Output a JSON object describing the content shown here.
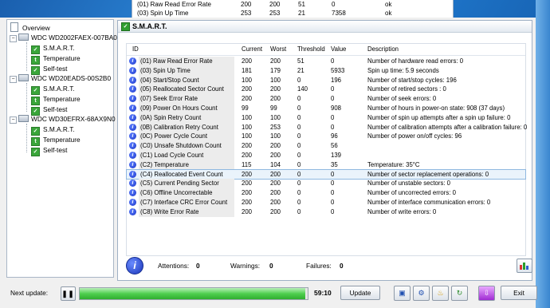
{
  "background_table": {
    "rows": [
      {
        "name": "(01) Raw Read Error Rate",
        "current": "200",
        "worst": "200",
        "threshold": "51",
        "value": "0",
        "status": "ok"
      },
      {
        "name": "(03) Spin Up Time",
        "current": "253",
        "worst": "253",
        "threshold": "21",
        "value": "7358",
        "status": "ok"
      }
    ]
  },
  "tree": {
    "overview": "Overview",
    "drives": [
      {
        "name": "WDC WD2002FAEX-007BA0",
        "children": [
          "S.M.A.R.T.",
          "Temperature",
          "Self-test"
        ]
      },
      {
        "name": "WDC WD20EADS-00S2B0",
        "children": [
          "S.M.A.R.T.",
          "Temperature",
          "Self-test"
        ]
      },
      {
        "name": "WDC WD30EFRX-68AX9N0",
        "children": [
          "S.M.A.R.T.",
          "Temperature",
          "Self-test"
        ]
      }
    ]
  },
  "panel": {
    "title": "S.M.A.R.T."
  },
  "smart_table": {
    "columns": [
      "ID",
      "Current",
      "Worst",
      "Threshold",
      "Value",
      "Description"
    ],
    "selected_index": 13,
    "rows": [
      {
        "id": "(01) Raw Read Error Rate",
        "current": "200",
        "worst": "200",
        "threshold": "51",
        "value": "0",
        "desc": "Number of hardware read errors: 0"
      },
      {
        "id": "(03) Spin Up Time",
        "current": "181",
        "worst": "179",
        "threshold": "21",
        "value": "5933",
        "desc": "Spin up time: 5.9 seconds"
      },
      {
        "id": "(04) Start/Stop Count",
        "current": "100",
        "worst": "100",
        "threshold": "0",
        "value": "196",
        "desc": "Number of start/stop cycles: 196"
      },
      {
        "id": "(05) Reallocated Sector Count",
        "current": "200",
        "worst": "200",
        "threshold": "140",
        "value": "0",
        "desc": "Number of retired sectors : 0"
      },
      {
        "id": "(07) Seek Error Rate",
        "current": "200",
        "worst": "200",
        "threshold": "0",
        "value": "0",
        "desc": "Number of seek errors: 0"
      },
      {
        "id": "(09) Power On Hours Count",
        "current": "99",
        "worst": "99",
        "threshold": "0",
        "value": "908",
        "desc": "Number of hours in power-on state: 908 (37 days)"
      },
      {
        "id": "(0A) Spin Retry Count",
        "current": "100",
        "worst": "100",
        "threshold": "0",
        "value": "0",
        "desc": "Number of spin up attempts after a spin up failure: 0"
      },
      {
        "id": "(0B) Calibration Retry Count",
        "current": "100",
        "worst": "253",
        "threshold": "0",
        "value": "0",
        "desc": "Number of calibration attempts after a calibration failure: 0"
      },
      {
        "id": "(0C) Power Cycle Count",
        "current": "100",
        "worst": "100",
        "threshold": "0",
        "value": "96",
        "desc": "Number of power on/off cycles: 96"
      },
      {
        "id": "(C0) Unsafe Shutdown Count",
        "current": "200",
        "worst": "200",
        "threshold": "0",
        "value": "56",
        "desc": ""
      },
      {
        "id": "(C1) Load Cycle Count",
        "current": "200",
        "worst": "200",
        "threshold": "0",
        "value": "139",
        "desc": ""
      },
      {
        "id": "(C2) Temperature",
        "current": "115",
        "worst": "104",
        "threshold": "0",
        "value": "35",
        "desc": "Temperature: 35°C"
      },
      {
        "id": "(C4) Reallocated Event Count",
        "current": "200",
        "worst": "200",
        "threshold": "0",
        "value": "0",
        "desc": "Number of sector replacement operations: 0"
      },
      {
        "id": "(C5) Current Pending Sector",
        "current": "200",
        "worst": "200",
        "threshold": "0",
        "value": "0",
        "desc": "Number of unstable sectors: 0"
      },
      {
        "id": "(C6) Offline Uncorrectable",
        "current": "200",
        "worst": "200",
        "threshold": "0",
        "value": "0",
        "desc": "Number of uncorrected errors: 0"
      },
      {
        "id": "(C7) Interface CRC Error Count",
        "current": "200",
        "worst": "200",
        "threshold": "0",
        "value": "0",
        "desc": "Number of interface communication errors: 0"
      },
      {
        "id": "(C8) Write Error Rate",
        "current": "200",
        "worst": "200",
        "threshold": "0",
        "value": "0",
        "desc": "Number of write errors: 0"
      }
    ]
  },
  "status": {
    "attentions_label": "Attentions:",
    "attentions": "0",
    "warnings_label": "Warnings:",
    "warnings": "0",
    "failures_label": "Failures:",
    "failures": "0"
  },
  "bottom": {
    "next_update_label": "Next update:",
    "progress_fraction": 0.99,
    "timer": "59:10",
    "update_label": "Update",
    "exit_label": "Exit"
  },
  "colors": {
    "progress_green": "#4fcf4f",
    "selected_row": "#eaf3fb",
    "info_blue": "#1c37c8"
  }
}
